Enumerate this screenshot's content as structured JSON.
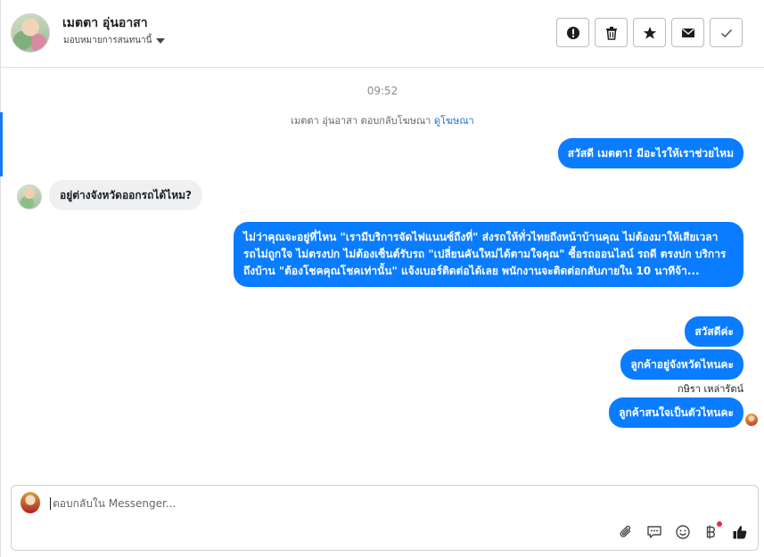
{
  "header": {
    "contact_name": "เมตตา อุ่นอาสา",
    "assign_label": "มอบหมายการสนทนานี้",
    "actions": [
      {
        "icon": "alert-icon",
        "name": "spam-button"
      },
      {
        "icon": "trash-icon",
        "name": "delete-button"
      },
      {
        "icon": "star-icon",
        "name": "star-button"
      },
      {
        "icon": "envelope-icon",
        "name": "mark-unread-button"
      },
      {
        "icon": "check-icon",
        "name": "mark-done-button"
      }
    ]
  },
  "thread": {
    "time": "09:52",
    "ad_reply_text": "เมตตา อุ่นอาสา ตอบกลับโฆษณา",
    "ad_link": "ดูโฆษณา",
    "messages": [
      {
        "from": "page",
        "text": "สวัสดี เมตตา! มีอะไรให้เราช่วยไหม"
      },
      {
        "from": "customer",
        "text": "อยู่ต่างจังหวัดออกรถได้ไหม?"
      },
      {
        "from": "page",
        "text": "ไม่ว่าคุณจะอยู่ที่ไหน \"เรามีบริการจัดไฟแนนซ์ถึงที่\"  ส่งรถให้ทั่วไทยถึงหน้าบ้านคุณ ไม่ต้องมาให้เสียเวลา รถไม่ถูกใจ ไม่ตรงปก ไม่ต้องเซ็นต์รับรถ \"เปลี่ยนคันใหม่ได้ตามใจคุณ\" ซื้อรถออนไลน์ รถดี ตรงปก บริการถึงบ้าน \"ต้องโชคคุณโชคเท่านั้น\" แจ้งเบอร์ติดต่อได้เลย พนักงานจะติดต่อกลับภายใน 10 นาทีจ้า..."
      },
      {
        "from": "page",
        "text": "สวัสดีค่ะ"
      },
      {
        "from": "page",
        "text": "ลูกค้าอยู่จังหวัดไหนคะ"
      },
      {
        "from": "page",
        "text": "ลูกค้าสนใจเป็นตัวไหนคะ"
      }
    ],
    "sender_name": "กษิรา เหล่ารัตน์"
  },
  "composer": {
    "placeholder": "ตอบกลับใน Messenger...",
    "tools": [
      "paperclip-icon",
      "speech-bubble-icon",
      "smiley-icon",
      "baht-icon",
      "thumbs-up-icon"
    ]
  },
  "colors": {
    "accent": "#1877f2",
    "outgoing_bubble": "#0a7cff",
    "incoming_bubble": "#eef0f2"
  }
}
